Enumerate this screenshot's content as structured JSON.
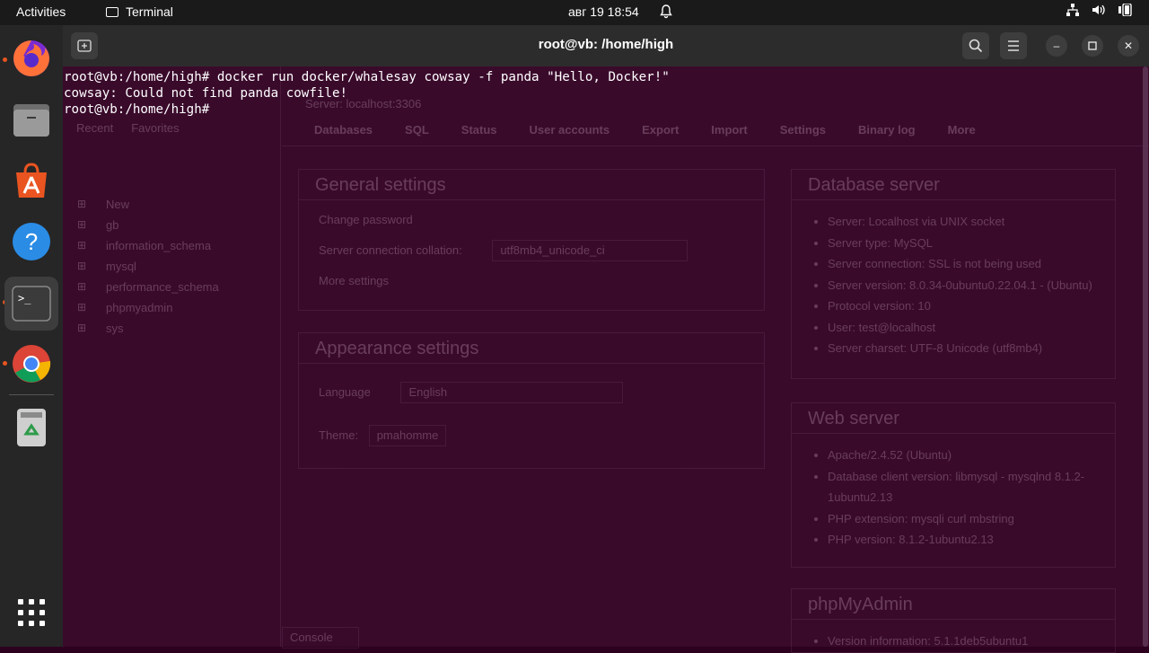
{
  "topbar": {
    "activities": "Activities",
    "app_name": "Terminal",
    "datetime": "авг 19  18:54"
  },
  "dock": {
    "items": [
      "firefox-icon",
      "files-icon",
      "app-center-icon",
      "help-icon",
      "terminal-icon",
      "chrome-icon",
      "trash-icon",
      "apps-grid-icon"
    ]
  },
  "window": {
    "title": "root@vb: /home/high"
  },
  "terminal": {
    "lines": [
      "root@vb:/home/high# docker run docker/whalesay cowsay -f panda \"Hello, Docker!\"",
      "cowsay: Could not find panda cowfile!",
      "root@vb:/home/high# "
    ]
  },
  "background_page": {
    "server_label": "Server: localhost:3306",
    "sidebar_tabs": [
      "Recent",
      "Favorites"
    ],
    "databases": [
      "New",
      "gb",
      "information_schema",
      "mysql",
      "performance_schema",
      "phpmyadmin",
      "sys"
    ],
    "tabs": [
      "Databases",
      "SQL",
      "Status",
      "User accounts",
      "Export",
      "Import",
      "Settings",
      "Binary log",
      "More"
    ],
    "general_settings": {
      "title": "General settings",
      "change_password": "Change password",
      "collation_label": "Server connection collation:",
      "collation_value": "utf8mb4_unicode_ci",
      "more_settings": "More settings"
    },
    "appearance_settings": {
      "title": "Appearance settings",
      "language_label": "Language",
      "language_value": "English",
      "theme_label": "Theme:",
      "theme_value": "pmahomme"
    },
    "database_server": {
      "title": "Database server",
      "items": [
        "Server: Localhost via UNIX socket",
        "Server type: MySQL",
        "Server connection: SSL is not being used",
        "Server version: 8.0.34-0ubuntu0.22.04.1 - (Ubuntu)",
        "Protocol version: 10",
        "User: test@localhost",
        "Server charset: UTF-8 Unicode (utf8mb4)"
      ]
    },
    "web_server": {
      "title": "Web server",
      "items": [
        "Apache/2.4.52 (Ubuntu)",
        "Database client version: libmysql - mysqlnd 8.1.2-1ubuntu2.13",
        "PHP extension: mysqli  curl  mbstring",
        "PHP version: 8.1.2-1ubuntu2.13"
      ]
    },
    "phpmyadmin": {
      "title": "phpMyAdmin",
      "items": [
        "Version information: 5.1.1deb5ubuntu1"
      ]
    },
    "console_label": "Console"
  }
}
